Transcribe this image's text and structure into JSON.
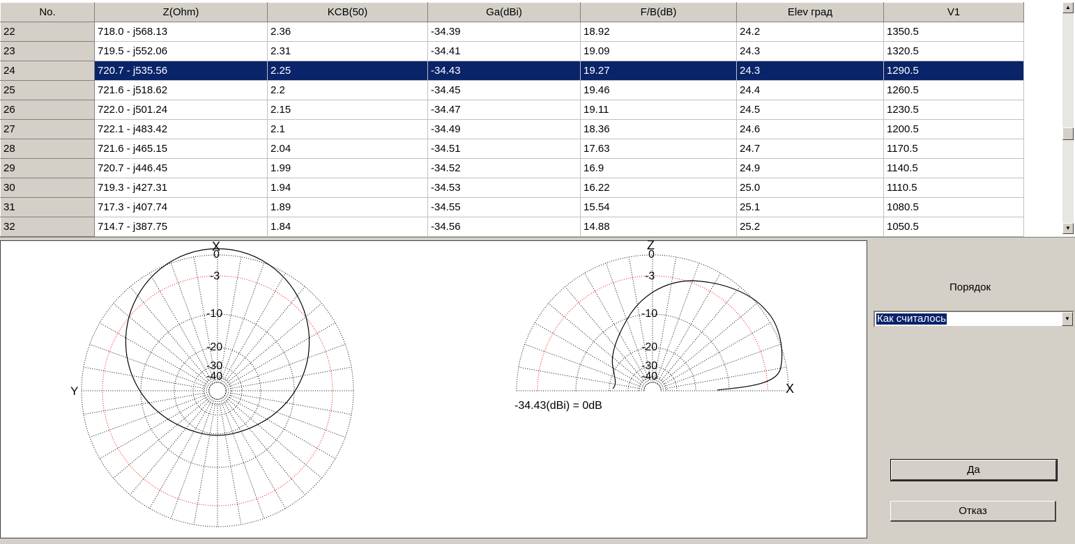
{
  "table": {
    "columns": [
      "No.",
      "Z(Ohm)",
      "KCB(50)",
      "Ga(dBi)",
      "F/B(dB)",
      "Elev град",
      "V1"
    ],
    "selected_row": "24",
    "rows": [
      [
        "22",
        "718.0 - j568.13",
        "2.36",
        "-34.39",
        "18.92",
        "24.2",
        "1350.5"
      ],
      [
        "23",
        "719.5 - j552.06",
        "2.31",
        "-34.41",
        "19.09",
        "24.3",
        "1320.5"
      ],
      [
        "24",
        "720.7 - j535.56",
        "2.25",
        "-34.43",
        "19.27",
        "24.3",
        "1290.5"
      ],
      [
        "25",
        "721.6 - j518.62",
        "2.2",
        "-34.45",
        "19.46",
        "24.4",
        "1260.5"
      ],
      [
        "26",
        "722.0 - j501.24",
        "2.15",
        "-34.47",
        "19.11",
        "24.5",
        "1230.5"
      ],
      [
        "27",
        "722.1 - j483.42",
        "2.1",
        "-34.49",
        "18.36",
        "24.6",
        "1200.5"
      ],
      [
        "28",
        "721.6 - j465.15",
        "2.04",
        "-34.51",
        "17.63",
        "24.7",
        "1170.5"
      ],
      [
        "29",
        "720.7 - j446.45",
        "1.99",
        "-34.52",
        "16.9",
        "24.9",
        "1140.5"
      ],
      [
        "30",
        "719.3 - j427.31",
        "1.94",
        "-34.53",
        "16.22",
        "25.0",
        "1110.5"
      ],
      [
        "31",
        "717.3 - j407.74",
        "1.89",
        "-34.55",
        "15.54",
        "25.1",
        "1080.5"
      ],
      [
        "32",
        "714.7 - j387.75",
        "1.84",
        "-34.56",
        "14.88",
        "25.2",
        "1050.5"
      ]
    ]
  },
  "plots": {
    "azimuth": {
      "axis_top": "X",
      "axis_left": "Y",
      "ring_labels": [
        "0",
        "-3",
        "-10",
        "-20",
        "-30",
        "-40"
      ]
    },
    "elevation": {
      "axis_top": "Z",
      "axis_right": "X",
      "ring_labels": [
        "0",
        "-3",
        "-10",
        "-20",
        "-30",
        "-40"
      ],
      "reference": "-34.43(dBi) = 0dB"
    },
    "colors": {
      "outer_grid": "#000000",
      "minus3_ring": "#ff0000",
      "pattern": "#000000"
    }
  },
  "panel": {
    "order_label": "Порядок",
    "order_value": "Как считалось",
    "ok_label": "Да",
    "cancel_label": "Отказ"
  },
  "icons": {
    "scroll_up": "scroll-up-arrow-icon",
    "scroll_down": "scroll-down-arrow-icon",
    "combo_arrow": "dropdown-arrow-icon"
  }
}
